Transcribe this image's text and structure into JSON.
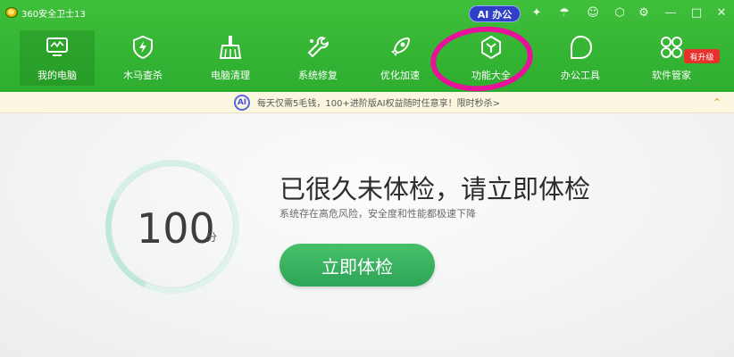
{
  "window": {
    "title": "360安全卫士13",
    "ai_button": "AI 办公"
  },
  "nav": {
    "items": [
      {
        "label": "我的电脑",
        "icon": "monitor-icon"
      },
      {
        "label": "木马查杀",
        "icon": "shield-bolt-icon"
      },
      {
        "label": "电脑清理",
        "icon": "broom-icon"
      },
      {
        "label": "系统修复",
        "icon": "wrench-icon"
      },
      {
        "label": "优化加速",
        "icon": "rocket-icon"
      },
      {
        "label": "功能大全",
        "icon": "hexagon-y-icon"
      },
      {
        "label": "办公工具",
        "icon": "leaf-icon"
      },
      {
        "label": "软件管家",
        "icon": "grid-icon"
      }
    ],
    "upgrade_badge": "有升级"
  },
  "promo": {
    "ai_mark": "AI",
    "text": "每天仅需5毛钱，100+进阶版AI权益随时任意享！限时秒杀>"
  },
  "main": {
    "score": "100",
    "score_unit": "分",
    "headline": "已很久未体检，请立即体检",
    "subline": "系统存在高危风险，安全度和性能都极速下降",
    "check_button": "立即体检"
  },
  "colors": {
    "brand_green": "#34b433",
    "button_green": "#2ea458",
    "annotation": "#e8129a"
  }
}
